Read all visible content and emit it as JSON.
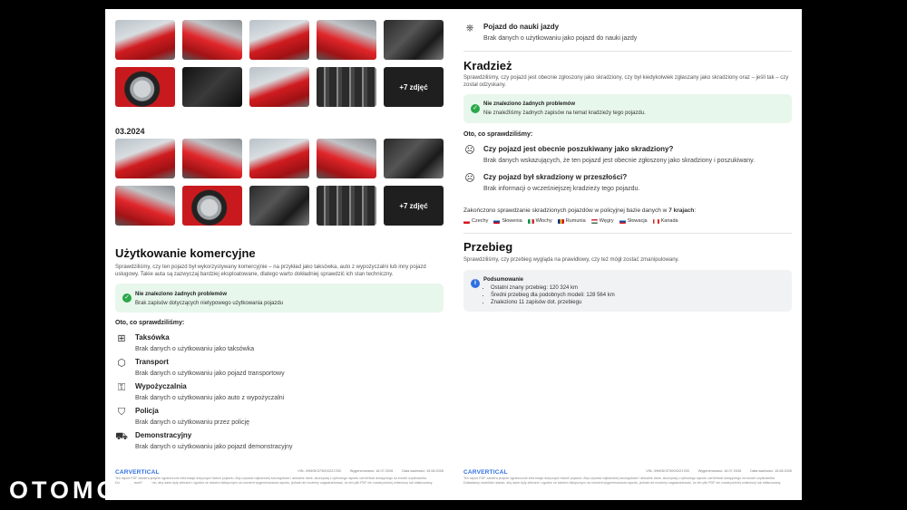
{
  "photos": {
    "more_label_1": "+7 zdjęć",
    "more_label_2": "+7 zdjęć",
    "date_label": "03.2024"
  },
  "commercial": {
    "title": "Użytkowanie komercyjne",
    "description": "Sprawdziliśmy, czy ten pojazd był wykorzystywany komercyjnie – na przykład jako taksówka, auto z wypożyczalni lub inny pojazd usługowy. Takie auta są zazwyczaj bardziej eksploatowane, dlatego warto dokładniej sprawdzić ich stan techniczny.",
    "ok_title": "Nie znaleziono żadnych problemów",
    "ok_text": "Brak zapisów dotyczących nietypowego użytkowania pojazdu",
    "checked_heading": "Oto, co sprawdziliśmy:",
    "items": [
      {
        "title": "Taksówka",
        "text": "Brak danych o użytkowaniu jako taksówka"
      },
      {
        "title": "Transport",
        "text": "Brak danych o użytkowaniu jako pojazd transportowy"
      },
      {
        "title": "Wypożyczalnia",
        "text": "Brak danych o użytkowaniu jako auto z wypożyczalni"
      },
      {
        "title": "Policja",
        "text": "Brak danych o użytkowaniu przez policję"
      },
      {
        "title": "Demonstracyjny",
        "text": "Brak danych o użytkowaniu jako pojazd demonstracyjny"
      }
    ]
  },
  "driving_school": {
    "title": "Pojazd do nauki jazdy",
    "text": "Brak danych o użytkowaniu jako pojazd do nauki jazdy"
  },
  "theft": {
    "title": "Kradzież",
    "description": "Sprawdziliśmy, czy pojazd jest obecnie zgłoszony jako skradziony, czy był kiedykolwiek zgłaszany jako skradziony oraz – jeśli tak – czy został odzyskany.",
    "ok_title": "Nie znaleziono żadnych problemów",
    "ok_text": "Nie znaleźliśmy żadnych zapisów na temat kradzieży tego pojazdu.",
    "checked_heading": "Oto, co sprawdziliśmy:",
    "items": [
      {
        "title": "Czy pojazd jest obecnie poszukiwany jako skradziony?",
        "text": "Brak danych wskazujących, że ten pojazd jest obecnie zgłoszony jako skradziony i poszukiwany."
      },
      {
        "title": "Czy pojazd był skradziony w przeszłości?",
        "text": "Brak informacji o wcześniejszej kradzieży tego pojazdu."
      }
    ],
    "summary_prefix": "Zakończono sprawdzanie skradzionych pojazdów w policyjnej bazie danych w ",
    "summary_count": "7 krajach",
    "summary_suffix": ":",
    "countries": [
      "Czechy",
      "Słowenia",
      "Włochy",
      "Rumunia",
      "Węgry",
      "Słowacja",
      "Kanada"
    ]
  },
  "mileage": {
    "title": "Przebieg",
    "description": "Sprawdziliśmy, czy przebieg wygląda na prawidłowy, czy też mógł zostać zmanipulowany.",
    "summary_title": "Podsumowanie",
    "lines": [
      "Ostatni znany przebieg: 120 324 km",
      "Średni przebieg dla podobnych modeli: 128 564 km",
      "Znaleziono 11 zapisów dot. przebiegu"
    ]
  },
  "footer": {
    "logo": "CARVERTICAL",
    "vin": "VIN: JHMGK37300X221783",
    "generated": "Wygenerowano: 16.07.2026",
    "valid": "Data ważności: 15.08.2026",
    "legal": "Ten raport PDF zawiera jedynie ograniczone informacje dotyczące historii pojazdu. Aby uzyskać najbardziej szczegółowe i aktualne dane, skorzystaj z cyfrowego raportu carVertical dostępnego na koncie użytkownika. Dokładamy wszelkich starań, aby dane były zebrane i zgodne ze stanem faktycznym na moment wygenerowania raportu, jednak nie możemy zagwarantować, że ten plik PDF nie został później zmieniony lub sfałszowany."
  },
  "watermark": "OTOMOTO",
  "colors": {
    "accent": "#2f6fe0",
    "ok": "#2ba84a",
    "ok_bg": "#e8f7ec"
  }
}
